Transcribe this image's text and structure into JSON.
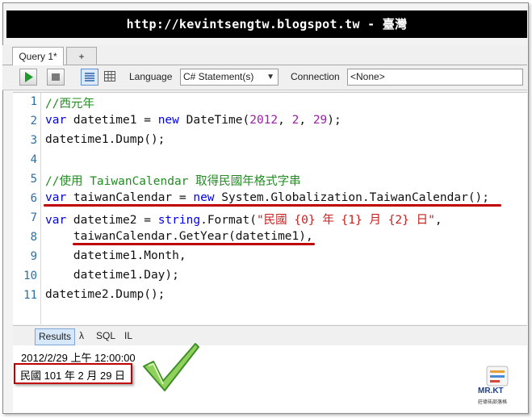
{
  "banner": {
    "text": "http://kevintsengtw.blogspot.tw - 臺灣"
  },
  "tabs": [
    {
      "label": "Query 1*"
    },
    {
      "label": "+"
    }
  ],
  "toolbar": {
    "run_icon": "play-icon",
    "stop_icon": "stop-icon",
    "language_label": "Language",
    "language_value": "C# Statement(s)",
    "connection_label": "Connection",
    "connection_value": "<None>"
  },
  "code_lines": [
    {
      "n": "1",
      "parts": [
        {
          "t": "//西元年",
          "c": "cm"
        }
      ]
    },
    {
      "n": "2",
      "parts": [
        {
          "t": "var",
          "c": "kw"
        },
        {
          "t": " datetime1 = ",
          "c": ""
        },
        {
          "t": "new",
          "c": "kw"
        },
        {
          "t": " DateTime(",
          "c": ""
        },
        {
          "t": "2012",
          "c": "num"
        },
        {
          "t": ", ",
          "c": ""
        },
        {
          "t": "2",
          "c": "num"
        },
        {
          "t": ", ",
          "c": ""
        },
        {
          "t": "29",
          "c": "num"
        },
        {
          "t": ");",
          "c": ""
        }
      ]
    },
    {
      "n": "3",
      "parts": [
        {
          "t": "datetime1.Dump();",
          "c": ""
        }
      ]
    },
    {
      "n": "4",
      "parts": []
    },
    {
      "n": "5",
      "parts": [
        {
          "t": "//使用 TaiwanCalendar 取得民國年格式字串",
          "c": "cm"
        }
      ]
    },
    {
      "n": "6",
      "parts": [
        {
          "t": "var",
          "c": "kw"
        },
        {
          "t": " taiwanCalendar = ",
          "c": ""
        },
        {
          "t": "new",
          "c": "kw"
        },
        {
          "t": " System.Globalization.TaiwanCalendar();",
          "c": ""
        }
      ]
    },
    {
      "n": "7",
      "parts": [
        {
          "t": "var",
          "c": "kw"
        },
        {
          "t": " datetime2 = ",
          "c": ""
        },
        {
          "t": "string",
          "c": "kw"
        },
        {
          "t": ".Format(",
          "c": ""
        },
        {
          "t": "\"民國 {0} 年 {1} 月 {2} 日\"",
          "c": "str"
        },
        {
          "t": ",",
          "c": ""
        }
      ]
    },
    {
      "n": "8",
      "parts": [
        {
          "t": "    taiwanCalendar.GetYear(datetime1),",
          "c": ""
        }
      ]
    },
    {
      "n": "9",
      "parts": [
        {
          "t": "    datetime1.Month,",
          "c": ""
        }
      ]
    },
    {
      "n": "10",
      "parts": [
        {
          "t": "    datetime1.Day);",
          "c": ""
        }
      ]
    },
    {
      "n": "11",
      "parts": [
        {
          "t": "datetime2.Dump();",
          "c": ""
        }
      ]
    }
  ],
  "result_tabs": {
    "results": "Results",
    "lambda": "λ",
    "sql": "SQL",
    "il": "IL"
  },
  "output": {
    "line1": "2012/2/29 上午 12:00:00",
    "line2": "民國 101 年 2 月 29 日"
  },
  "logo": {
    "text": "MR.KT",
    "subtext": "莊德祐部落格"
  },
  "colors": {
    "keyword": "#0000ee",
    "comment": "#228b22",
    "number": "#9b1fa8",
    "string": "#c81e1e",
    "highlight": "#c00000",
    "check": "#6fbf3f"
  }
}
